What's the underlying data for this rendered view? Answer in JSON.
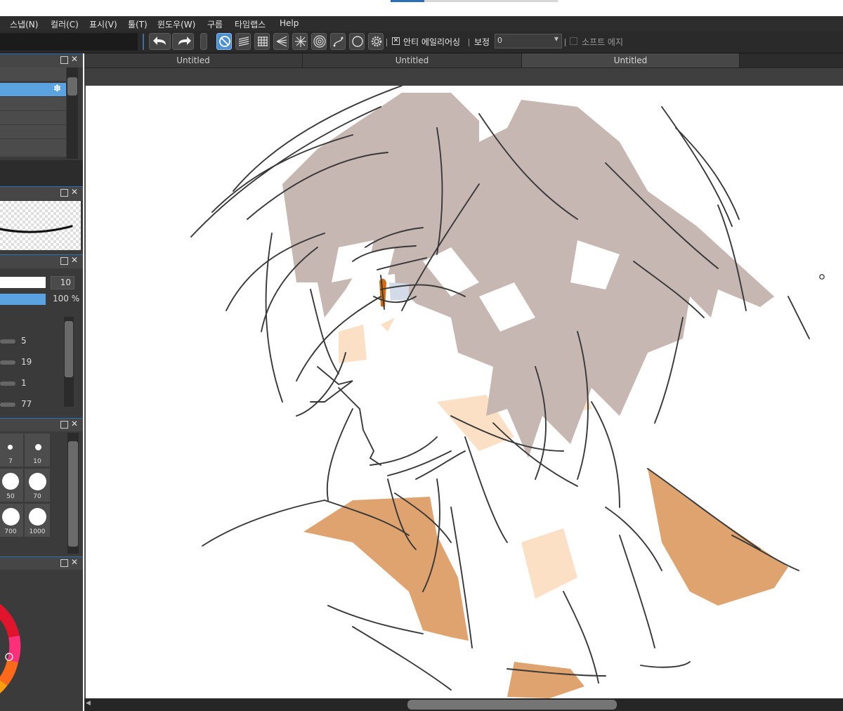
{
  "menu": {
    "items": [
      "스냅(N)",
      "컬러(C)",
      "표시(V)",
      "툴(T)",
      "윈도우(W)",
      "구름",
      "타임랩스",
      "Help"
    ]
  },
  "toolbar": {
    "antialias_label": "안티 에일리어싱",
    "correction_label": "보정",
    "correction_value": "0",
    "soft_edge_label": "소프트 에지",
    "antialias_checked": true,
    "soft_edge_checked": false
  },
  "tabs": [
    "Untitled",
    "Untitled",
    "Untitled"
  ],
  "brush_control": {
    "size_value": "10",
    "opacity_value": "100 %",
    "param_values": [
      "5",
      "19",
      "1",
      "77"
    ]
  },
  "brush_sizes": [
    {
      "label": "7"
    },
    {
      "label": "10"
    },
    {
      "label": "50"
    },
    {
      "label": "70"
    },
    {
      "label": "700"
    },
    {
      "label": "1000"
    }
  ],
  "colors": {
    "accent": "#5aa2e0",
    "skin": "#fbe0c6",
    "hair": "#c6b7b2",
    "collar": "#dfa36f",
    "iris": "#d36a12"
  }
}
